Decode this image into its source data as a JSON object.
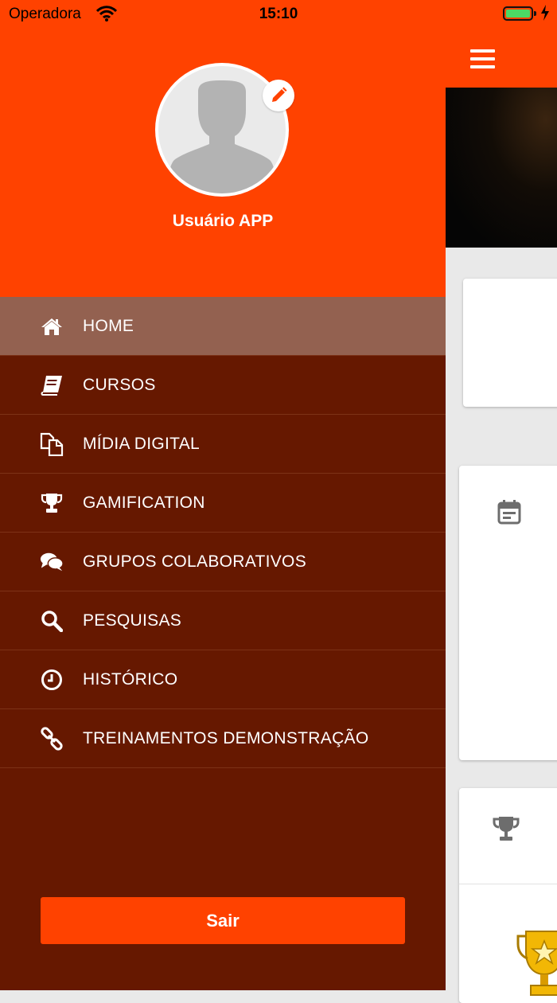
{
  "status_bar": {
    "carrier": "Operadora",
    "time": "15:10"
  },
  "profile": {
    "name": "Usuário APP"
  },
  "menu": {
    "items": [
      {
        "label": "HOME",
        "icon": "home-icon",
        "active": true
      },
      {
        "label": "CURSOS",
        "icon": "book-icon"
      },
      {
        "label": "MÍDIA DIGITAL",
        "icon": "files-icon"
      },
      {
        "label": "GAMIFICATION",
        "icon": "trophy-icon"
      },
      {
        "label": "GRUPOS COLABORATIVOS",
        "icon": "comments-icon"
      },
      {
        "label": "PESQUISAS",
        "icon": "search-icon"
      },
      {
        "label": "HISTÓRICO",
        "icon": "clock-icon"
      },
      {
        "label": "TREINAMENTOS DEMONSTRAÇÃO",
        "icon": "link-icon"
      }
    ]
  },
  "logout": {
    "label": "Sair"
  },
  "colors": {
    "brand": "#ff4200",
    "drawer_bg": "#661800",
    "active_item": "#936150"
  }
}
